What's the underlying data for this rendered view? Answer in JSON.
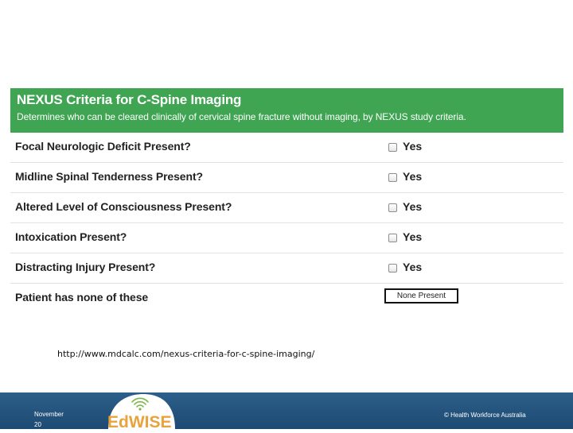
{
  "card": {
    "title": "NEXUS Criteria for C-Spine Imaging",
    "subtitle": "Determines who can be cleared clinically of cervical spine fracture without imaging, by NEXUS study criteria.",
    "header_color": "#3fa552",
    "criteria": [
      {
        "label": "Focal Neurologic Deficit Present?",
        "option": "Yes",
        "checked": false
      },
      {
        "label": "Midline Spinal Tenderness Present?",
        "option": "Yes",
        "checked": false
      },
      {
        "label": "Altered Level of Consciousness Present?",
        "option": "Yes",
        "checked": false
      },
      {
        "label": "Intoxication Present?",
        "option": "Yes",
        "checked": false
      },
      {
        "label": "Distracting Injury Present?",
        "option": "Yes",
        "checked": false
      }
    ],
    "none_row": {
      "label": "Patient has none of these",
      "button": "None Present"
    }
  },
  "source_url": "http://www.mdcalc.com/nexus-criteria-for-c-spine-imaging/",
  "footer": {
    "date_line1": "November",
    "date_line2": "20",
    "logo_text": "EdWISE",
    "logo_icon": "wifi-signal-icon",
    "copyright": "© Health Workforce Australia",
    "background_color": "#24557f"
  }
}
